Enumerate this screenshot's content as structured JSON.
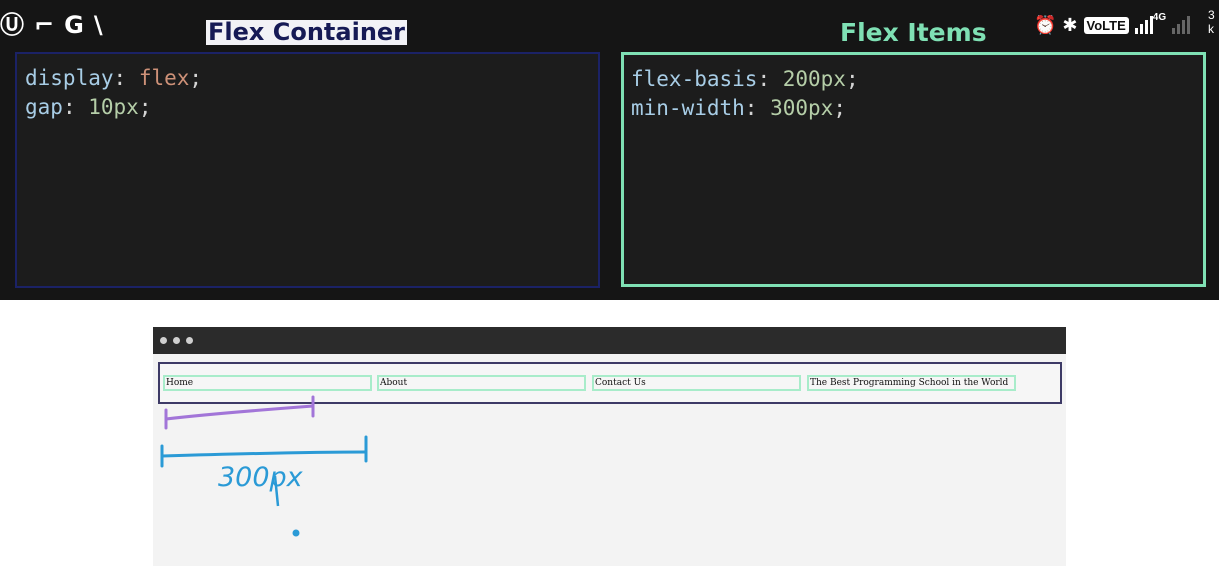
{
  "status_bar": {
    "left_icons": [
      "u-app-icon",
      "gun-icon",
      "google-icon",
      "slash-icon"
    ],
    "right_icons": [
      "alarm-icon",
      "bluetooth-icon",
      "volte-badge",
      "signal-bars-icon",
      "signal-bars-dim-icon"
    ],
    "volte_label": "VoLTE",
    "network_label": "4G",
    "edge_text": [
      "3",
      "k"
    ]
  },
  "headings": {
    "flex_container": "Flex Container",
    "flex_items": "Flex Items"
  },
  "container_css": [
    {
      "property": "display",
      "value": "flex",
      "value_kind": "keyword"
    },
    {
      "property": "gap",
      "value": "10px",
      "value_kind": "number"
    }
  ],
  "items_css": [
    {
      "property": "flex-basis",
      "value": "200px",
      "value_kind": "number"
    },
    {
      "property": "min-width",
      "value": "300px",
      "value_kind": "number"
    }
  ],
  "browser": {
    "nav_items": [
      "Home",
      "About",
      "Contact Us",
      "The Best Programming School in the World"
    ]
  },
  "annotation": {
    "handwritten_label": "300px"
  },
  "colors": {
    "flex_items_accent": "#7fe0b4",
    "flex_container_accent": "#1b2266",
    "annotation_purple": "#a275d8",
    "annotation_blue": "#2a9ad6"
  }
}
